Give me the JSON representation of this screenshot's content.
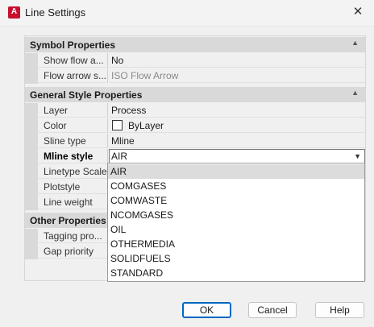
{
  "window": {
    "title": "Line Settings",
    "icon_letter": "A",
    "close_glyph": "✕"
  },
  "sections": {
    "symbol": "Symbol Properties",
    "general": "General Style Properties",
    "other": "Other Properties",
    "collapse_glyph": "▲"
  },
  "symbol_rows": [
    {
      "name": "Show flow a...",
      "value": "No"
    },
    {
      "name": "Flow arrow s...",
      "value": "ISO Flow Arrow"
    }
  ],
  "general_rows": {
    "layer": {
      "name": "Layer",
      "value": "Process"
    },
    "color": {
      "name": "Color",
      "value": "ByLayer"
    },
    "sline": {
      "name": "Sline type",
      "value": "Mline"
    },
    "mline": {
      "name": "Mline style",
      "value": "AIR"
    },
    "linetype": {
      "name": "Linetype Scale"
    },
    "plotstyle": {
      "name": "Plotstyle"
    },
    "lineweight": {
      "name": "Line weight"
    }
  },
  "other_rows": [
    {
      "name": "Tagging pro..."
    },
    {
      "name": "Gap priority"
    }
  ],
  "combo_arrow": "▼",
  "dropdown_options": [
    "AIR",
    "COMGASES",
    "COMWASTE",
    "NCOMGASES",
    "OIL",
    "OTHERMEDIA",
    "SOLIDFUELS",
    "STANDARD"
  ],
  "dropdown_selected": "AIR",
  "buttons": {
    "ok": "OK",
    "cancel": "Cancel",
    "help": "Help"
  }
}
